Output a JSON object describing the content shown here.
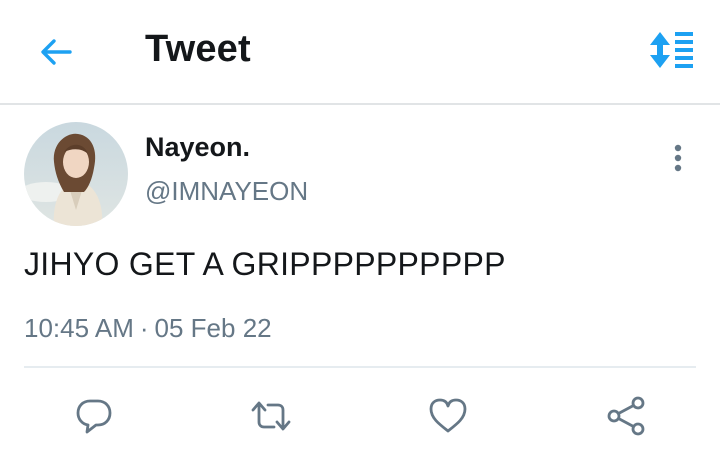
{
  "header": {
    "title": "Tweet",
    "back_icon": "arrow-left-icon",
    "sort_icon": "sort-list-icon"
  },
  "tweet": {
    "display_name": "Nayeon.",
    "handle": "@IMNAYEON",
    "text": "JIHYO GET A GRIPPPPPPPPPP",
    "time": "10:45 AM",
    "separator": "·",
    "date": "05 Feb 22"
  },
  "actions": [
    {
      "icon": "reply-icon"
    },
    {
      "icon": "retweet-icon"
    },
    {
      "icon": "like-icon"
    },
    {
      "icon": "share-icon"
    }
  ],
  "colors": {
    "accent": "#1da1f2",
    "secondary_text": "#657786",
    "icon_gray": "#657786",
    "divider": "#e1e4e6"
  }
}
